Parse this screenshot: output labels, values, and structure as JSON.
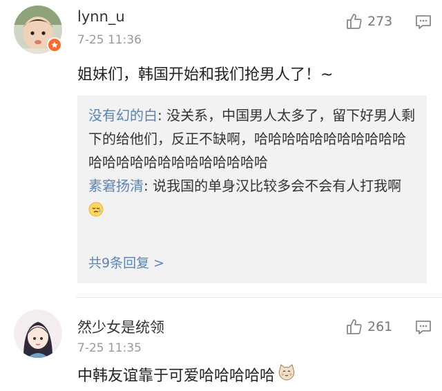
{
  "comments": [
    {
      "username": "lynn_u",
      "time": "7-25 11:36",
      "likes": "273",
      "text": "姐妹们，韩国开始和我们抢男人了！~",
      "replies": [
        {
          "author": "没有幻的白",
          "text": ": 没关系，中国男人太多了，留下好男人剩下的给他们，反正不缺啊，哈哈哈哈哈哈哈哈哈哈哈哈哈哈哈哈哈哈哈哈哈哈哈哈"
        },
        {
          "author": "素窘扬清",
          "text": ": 说我国的单身汉比较多会不会有人打我啊"
        }
      ],
      "more_replies": "共9条回复 >"
    },
    {
      "username": "然少女是统领",
      "time": "7-25 11:35",
      "likes": "261",
      "text": "中韩友谊靠于可爱哈哈哈哈哈"
    }
  ],
  "icons": {
    "like": "thumbs-up-icon",
    "reply": "comment-icon",
    "badge": "verified-badge-icon",
    "emoji1": "sleepy-face-emoji",
    "emoji2": "cat-face-emoji"
  },
  "colors": {
    "link": "#5b83b5",
    "reply_bg": "#f2f2f2",
    "muted": "#999999",
    "badge": "#ff6a2a"
  }
}
